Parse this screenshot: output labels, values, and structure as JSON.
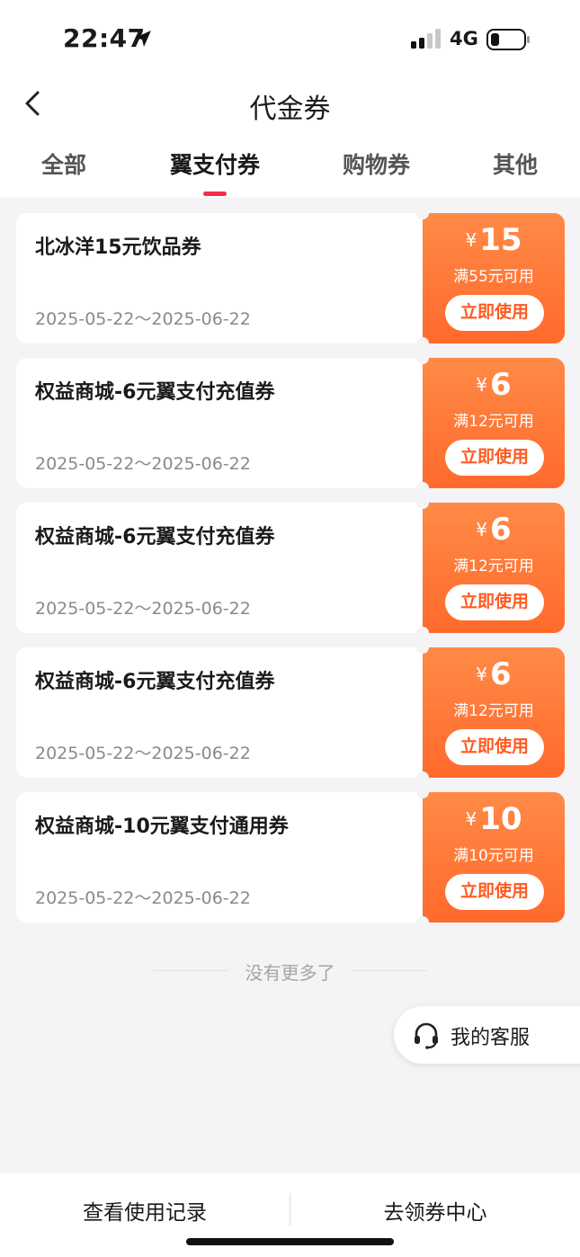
{
  "status_bar": {
    "time": "22:47",
    "network": "4G",
    "icons": [
      "location-arrow-icon",
      "signal-icon",
      "battery-icon"
    ]
  },
  "nav": {
    "title": "代金券",
    "back_icon": "chevron-left-icon"
  },
  "tabs": [
    {
      "label": "全部",
      "active": false
    },
    {
      "label": "翼支付券",
      "active": true
    },
    {
      "label": "购物券",
      "active": false
    },
    {
      "label": "其他",
      "active": false
    }
  ],
  "coupons": [
    {
      "name": "北冰洋15元饮品券",
      "date": "2025-05-22～2025-06-22",
      "currency": "¥",
      "amount": "15",
      "condition": "满55元可用",
      "button": "立即使用"
    },
    {
      "name": "权益商城-6元翼支付充值券",
      "date": "2025-05-22～2025-06-22",
      "currency": "¥",
      "amount": "6",
      "condition": "满12元可用",
      "button": "立即使用"
    },
    {
      "name": "权益商城-6元翼支付充值券",
      "date": "2025-05-22～2025-06-22",
      "currency": "¥",
      "amount": "6",
      "condition": "满12元可用",
      "button": "立即使用"
    },
    {
      "name": "权益商城-6元翼支付充值券",
      "date": "2025-05-22～2025-06-22",
      "currency": "¥",
      "amount": "6",
      "condition": "满12元可用",
      "button": "立即使用"
    },
    {
      "name": "权益商城-10元翼支付通用券",
      "date": "2025-05-22～2025-06-22",
      "currency": "¥",
      "amount": "10",
      "condition": "满10元可用",
      "button": "立即使用"
    }
  ],
  "list_end_text": "没有更多了",
  "customer_service": {
    "label": "我的客服",
    "icon": "headset-icon"
  },
  "bottom_bar": {
    "left_label": "查看使用记录",
    "right_label": "去领券中心"
  },
  "colors": {
    "accent_red": "#f0304a",
    "coupon_orange_top": "#ff8a47",
    "coupon_orange_bottom": "#ff6a2c",
    "button_text": "#ff5a1f",
    "background": "#f4f4f6"
  }
}
